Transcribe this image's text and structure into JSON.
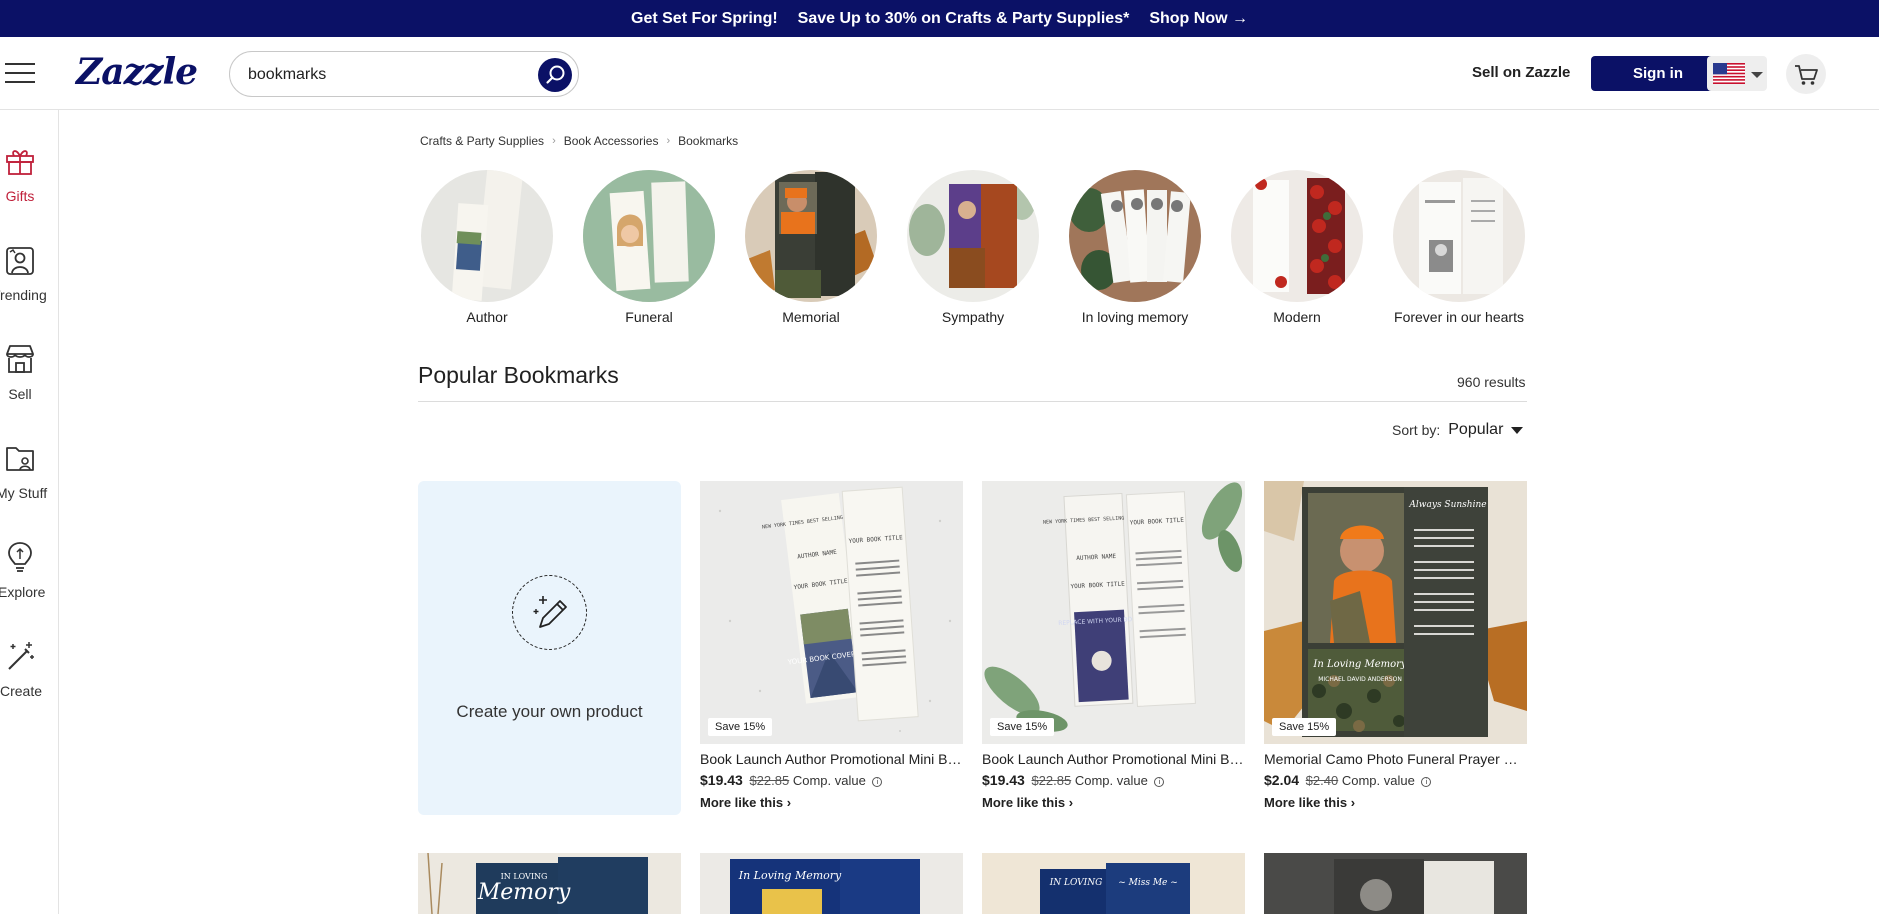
{
  "promo": {
    "headline": "Get Set For Spring!",
    "offer": "Save Up to 30% on Crafts & Party Supplies*",
    "cta": "Shop Now →"
  },
  "header": {
    "logo": "Zazzle",
    "search_value": "bookmarks",
    "sell_link": "Sell on Zazzle",
    "signin": "Sign in"
  },
  "sidebar": [
    {
      "label": "Gifts",
      "icon": "gift-icon"
    },
    {
      "label": "Trending",
      "icon": "trending-icon"
    },
    {
      "label": "Sell",
      "icon": "store-icon"
    },
    {
      "label": "My Stuff",
      "icon": "folder-icon"
    },
    {
      "label": "Explore",
      "icon": "lightbulb-icon"
    },
    {
      "label": "Create",
      "icon": "magic-wand-icon"
    }
  ],
  "breadcrumb": [
    "Crafts & Party Supplies",
    "Book Accessories",
    "Bookmarks"
  ],
  "categories": [
    "Author",
    "Funeral",
    "Memorial",
    "Sympathy",
    "In loving memory",
    "Modern",
    "Forever in our hearts"
  ],
  "listing": {
    "title": "Popular Bookmarks",
    "results": "960 results",
    "sort_label": "Sort by:",
    "sort_value": "Popular"
  },
  "create_card": {
    "label": "Create your own product"
  },
  "products": [
    {
      "badge": "Save 15%",
      "title": "Book Launch Author Promotional Mini Bookmark",
      "price": "$19.43",
      "was": "$22.85",
      "comp": "Comp. value",
      "more": "More like this"
    },
    {
      "badge": "Save 15%",
      "title": "Book Launch Author Promotional Mini Bookmark",
      "price": "$19.43",
      "was": "$22.85",
      "comp": "Comp. value",
      "more": "More like this"
    },
    {
      "badge": "Save 15%",
      "title": "Memorial Camo Photo Funeral Prayer Card Bookmark",
      "price": "$2.04",
      "was": "$2.40",
      "comp": "Comp. value",
      "more": "More like this"
    }
  ],
  "image_text": {
    "book_author": "NEW YORK TIMES BEST SELLING AUTHOR",
    "author_name": "AUTHOR NAME",
    "your_book_title": "YOUR BOOK TITLE",
    "cover_art": "YOUR BOOK COVER ART",
    "replace": "REPLACE WITH YOUR BOOK",
    "in_loving_memory": "In Loving Memory",
    "camo_name": "MICHAEL DAVID ANDERSON",
    "sunshine": "Always Sunshine",
    "memory": "Memory",
    "in_loving": "IN LOVING",
    "miss_me": "~ Miss Me ~"
  },
  "colors": {
    "brand_navy": "#0b1166",
    "gift_red": "#c0213b",
    "create_bg": "#eaf4fc"
  }
}
